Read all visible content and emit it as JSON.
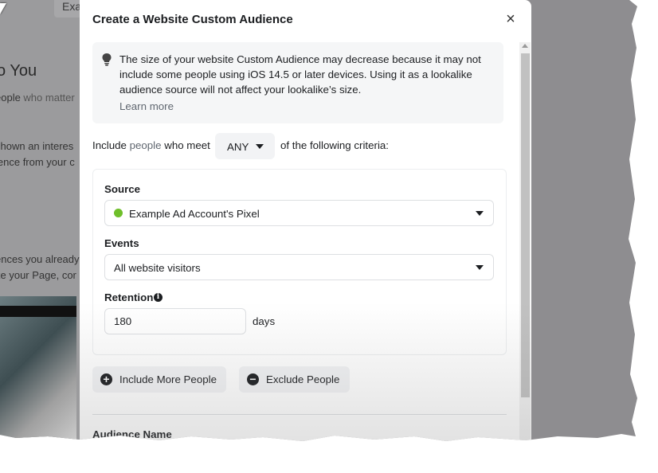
{
  "background": {
    "tab_label": "Exa",
    "heading": "o You",
    "lines": [
      {
        "pre": "eople ",
        "muted": "who matter"
      },
      {
        "pre": "shown an interes",
        "muted": ""
      },
      {
        "pre": "ience from your c",
        "muted": ""
      },
      {
        "pre": "ences you already",
        "muted": ""
      },
      {
        "pre": "ke your Page, cor",
        "muted": ""
      }
    ]
  },
  "modal": {
    "title": "Create a Website Custom Audience",
    "close_icon": "×",
    "notice": {
      "icon": "lightbulb-icon",
      "text": "The size of your website Custom Audience may decrease because it may not include some people using iOS 14.5 or later devices. Using it as a lookalike audience source will not affect your lookalike’s size.",
      "learn_more": "Learn more"
    },
    "criteria": {
      "prefix": "Include ",
      "people": "people",
      "mid": " who meet",
      "match_value": "ANY",
      "suffix": "of the following criteria:"
    },
    "rule": {
      "source_label": "Source",
      "source_value": "Example Ad Account's Pixel",
      "source_status_color": "#6fbf2a",
      "events_label": "Events",
      "events_value": "All website visitors",
      "retention_label": "Retention",
      "retention_info_icon": "i",
      "retention_value": "180",
      "retention_unit": "days"
    },
    "actions": {
      "include_label": "Include More People",
      "include_icon": "+",
      "exclude_label": "Exclude People",
      "exclude_icon": "−"
    },
    "audience_name_label": "Audience Name"
  }
}
